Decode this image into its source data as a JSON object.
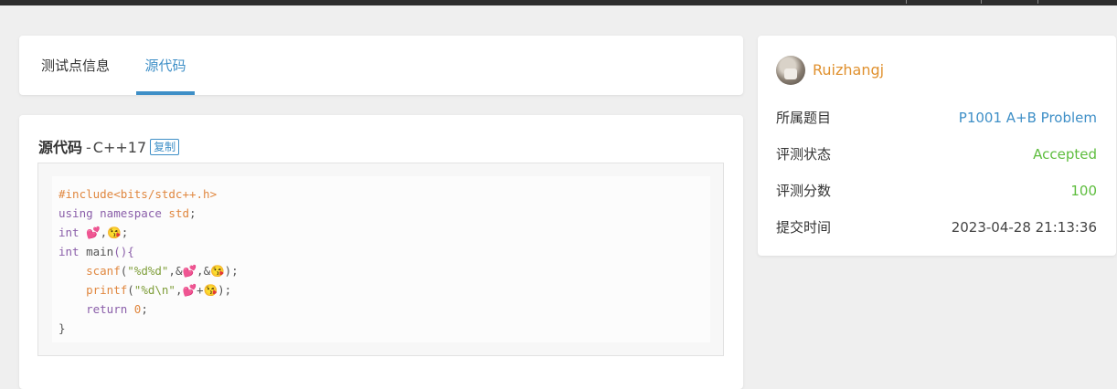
{
  "tabs": [
    {
      "label": "测试点信息"
    },
    {
      "label": "源代码"
    }
  ],
  "source": {
    "title": "源代码",
    "dash": "-",
    "language": "C++17",
    "copy_label": "复制",
    "code": {
      "l1": "#include<bits/stdc++.h>",
      "l2_kw": "using namespace",
      "l2_id": " std",
      "l2_end": ";",
      "l3_kw": "int",
      "l3_rest": " 💕,😘;",
      "l4_kw": "int",
      "l4_fn": " main",
      "l4_end": "(){",
      "l5_fn": "    scanf",
      "l5_p": "(",
      "l5_str": "\"%d%d\"",
      "l5_rest": ",&💕,&😘);",
      "l6_fn": "    printf",
      "l6_p": "(",
      "l6_str": "\"%d\\n\"",
      "l6_rest": ",💕+😘);",
      "l7_kw": "    return",
      "l7_num": " 0",
      "l7_end": ";",
      "l8": "}"
    }
  },
  "info": {
    "username": "Ruizhangj",
    "rows": [
      {
        "key": "所属题目",
        "value": "P1001 A+B Problem"
      },
      {
        "key": "评测状态",
        "value": "Accepted"
      },
      {
        "key": "评测分数",
        "value": "100"
      },
      {
        "key": "提交时间",
        "value": "2023-04-28 21:13:36"
      }
    ]
  },
  "colors": {
    "accent": "#3e8fc7",
    "accepted": "#5ebd3e",
    "username": "#e0912f"
  }
}
